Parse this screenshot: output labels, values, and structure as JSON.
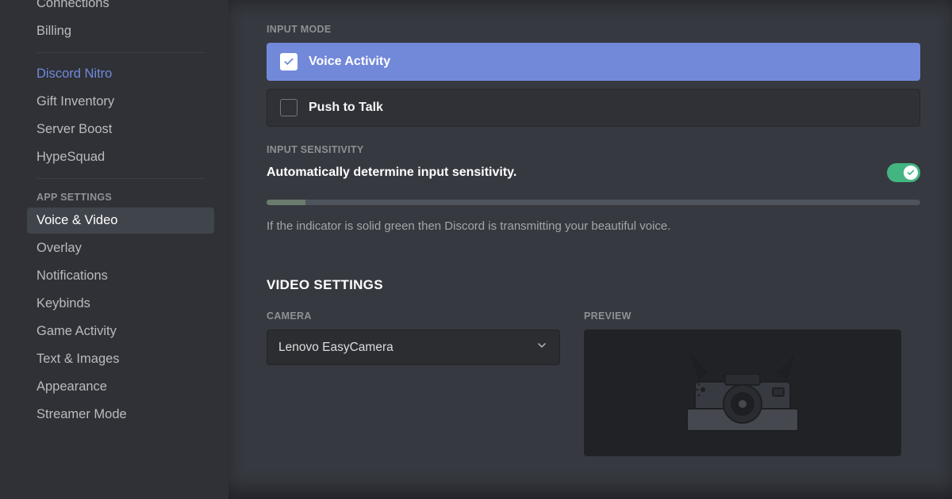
{
  "sidebar": {
    "items_top": [
      {
        "label": "Connections"
      },
      {
        "label": "Billing"
      }
    ],
    "items_nitro": [
      {
        "label": "Discord Nitro",
        "nitro": true
      },
      {
        "label": "Gift Inventory"
      },
      {
        "label": "Server Boost"
      },
      {
        "label": "HypeSquad"
      }
    ],
    "app_header": "APP SETTINGS",
    "items_app": [
      {
        "label": "Voice & Video",
        "active": true
      },
      {
        "label": "Overlay"
      },
      {
        "label": "Notifications"
      },
      {
        "label": "Keybinds"
      },
      {
        "label": "Game Activity"
      },
      {
        "label": "Text & Images"
      },
      {
        "label": "Appearance"
      },
      {
        "label": "Streamer Mode"
      }
    ]
  },
  "input_mode": {
    "label": "INPUT MODE",
    "options": [
      {
        "label": "Voice Activity",
        "selected": true
      },
      {
        "label": "Push to Talk",
        "selected": false
      }
    ]
  },
  "input_sensitivity": {
    "label": "INPUT SENSITIVITY",
    "auto_label": "Automatically determine input sensitivity.",
    "auto_enabled": true,
    "hint": "If the indicator is solid green then Discord is transmitting your beautiful voice."
  },
  "video": {
    "title": "VIDEO SETTINGS",
    "camera_label": "CAMERA",
    "camera_value": "Lenovo EasyCamera",
    "preview_label": "PREVIEW"
  }
}
